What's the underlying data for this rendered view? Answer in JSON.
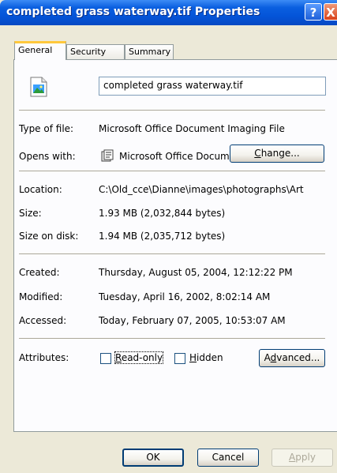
{
  "window": {
    "title": "completed grass waterway.tif Properties",
    "help_label": "?",
    "close_label": "X"
  },
  "tabs": [
    {
      "label": "General"
    },
    {
      "label": "Security"
    },
    {
      "label": "Summary"
    }
  ],
  "file": {
    "name": "completed grass waterway.tif"
  },
  "rows": {
    "type": {
      "label": "Type of file:",
      "value": "Microsoft Office Document Imaging File"
    },
    "opens": {
      "label": "Opens with:",
      "value": "Microsoft Office Docum",
      "button_prefix": "",
      "button_ul": "C",
      "button_rest": "hange..."
    },
    "location": {
      "label": "Location:",
      "value": "C:\\Old_cce\\Dianne\\images\\photographs\\Art"
    },
    "size": {
      "label": "Size:",
      "value": "1.93 MB (2,032,844 bytes)"
    },
    "size_on_disk": {
      "label": "Size on disk:",
      "value": "1.94 MB (2,035,712 bytes)"
    },
    "created": {
      "label": "Created:",
      "value": "Thursday, August 05, 2004, 12:12:22 PM"
    },
    "modified": {
      "label": "Modified:",
      "value": "Tuesday, April 16, 2002, 8:02:14 AM"
    },
    "accessed": {
      "label": "Accessed:",
      "value": "Today, February 07, 2005, 10:53:07 AM"
    }
  },
  "attributes": {
    "label": "Attributes:",
    "readonly_ul": "R",
    "readonly_rest": "ead-only",
    "readonly_checked": false,
    "hidden_ul": "H",
    "hidden_rest": "idden",
    "hidden_checked": false,
    "advanced_prefix": "A",
    "advanced_ul": "d",
    "advanced_rest": "vanced..."
  },
  "footer": {
    "ok": "OK",
    "cancel": "Cancel",
    "apply_ul": "A",
    "apply_rest": "pply"
  },
  "colors": {
    "titlebar": "#0454d8",
    "dialog_bg": "#ece9d8",
    "active_tab_accent": "#ffc83c"
  }
}
